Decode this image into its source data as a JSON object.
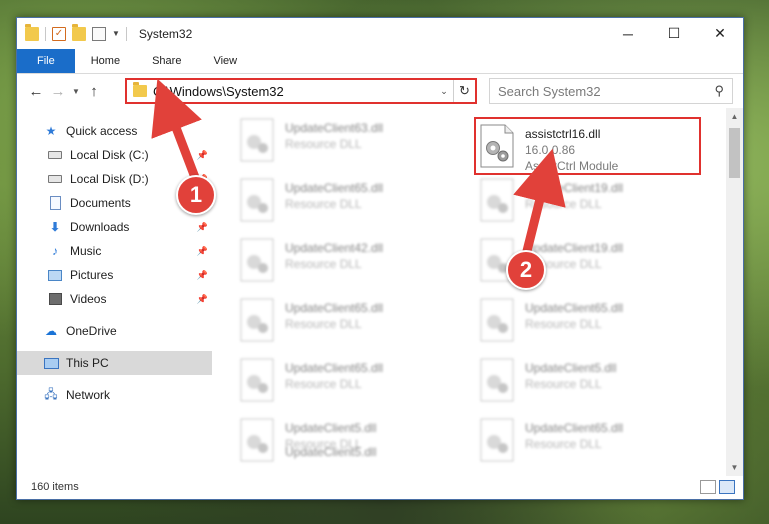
{
  "window": {
    "title": "System32",
    "controls": {
      "minimize": "─",
      "maximize": "☐",
      "close": "✕"
    }
  },
  "ribbon": {
    "tabs": [
      "File",
      "Home",
      "Share",
      "View"
    ]
  },
  "address": {
    "path": "C:\\Windows\\System32"
  },
  "search": {
    "placeholder": "Search System32"
  },
  "sidebar": {
    "items": [
      {
        "label": "Quick access",
        "icon": "star-icon"
      },
      {
        "label": "Local Disk (C:)",
        "icon": "disk-icon",
        "pinned": true
      },
      {
        "label": "Local Disk (D:)",
        "icon": "disk-icon",
        "pinned": true
      },
      {
        "label": "Documents",
        "icon": "documents-icon",
        "pinned": true
      },
      {
        "label": "Downloads",
        "icon": "download-icon",
        "pinned": true
      },
      {
        "label": "Music",
        "icon": "music-icon",
        "pinned": true
      },
      {
        "label": "Pictures",
        "icon": "pictures-icon",
        "pinned": true
      },
      {
        "label": "Videos",
        "icon": "videos-icon",
        "pinned": true
      },
      {
        "label": "OneDrive",
        "icon": "cloud-icon"
      },
      {
        "label": "This PC",
        "icon": "computer-icon",
        "selected": true
      },
      {
        "label": "Network",
        "icon": "network-icon"
      }
    ]
  },
  "files": {
    "highlighted": {
      "name": "assistctrl16.dll",
      "version": "16.0.0.86",
      "description": "AssistCtrl Module"
    },
    "left_column": [
      {
        "name": "UpdateClient63.dll",
        "type": "Resource DLL"
      },
      {
        "name": "UpdateClient65.dll",
        "type": "Resource DLL"
      },
      {
        "name": "UpdateClient42.dll",
        "type": "Resource DLL"
      },
      {
        "name": "UpdateClient65.dll",
        "type": "Resource DLL"
      },
      {
        "name": "UpdateClient65.dll",
        "type": "Resource DLL"
      },
      {
        "name": "UpdateClient5.dll",
        "type": "Resource DLL"
      },
      {
        "name": "UpdateClient5.dll",
        "type": "Resource DLL"
      }
    ],
    "right_column": [
      {
        "name": "UpdateClient19.dll",
        "type": "Resource DLL"
      },
      {
        "name": "UpdateClient19.dll",
        "type": "Resource DLL"
      },
      {
        "name": "UpdateClient65.dll",
        "type": "Resource DLL"
      },
      {
        "name": "UpdateClient5.dll",
        "type": "Resource DLL"
      },
      {
        "name": "UpdateClient65.dll",
        "type": "Resource DLL"
      }
    ]
  },
  "status": {
    "item_count": "160 items"
  },
  "annotations": {
    "step1": "1",
    "step2": "2",
    "color": "#e1413a"
  }
}
